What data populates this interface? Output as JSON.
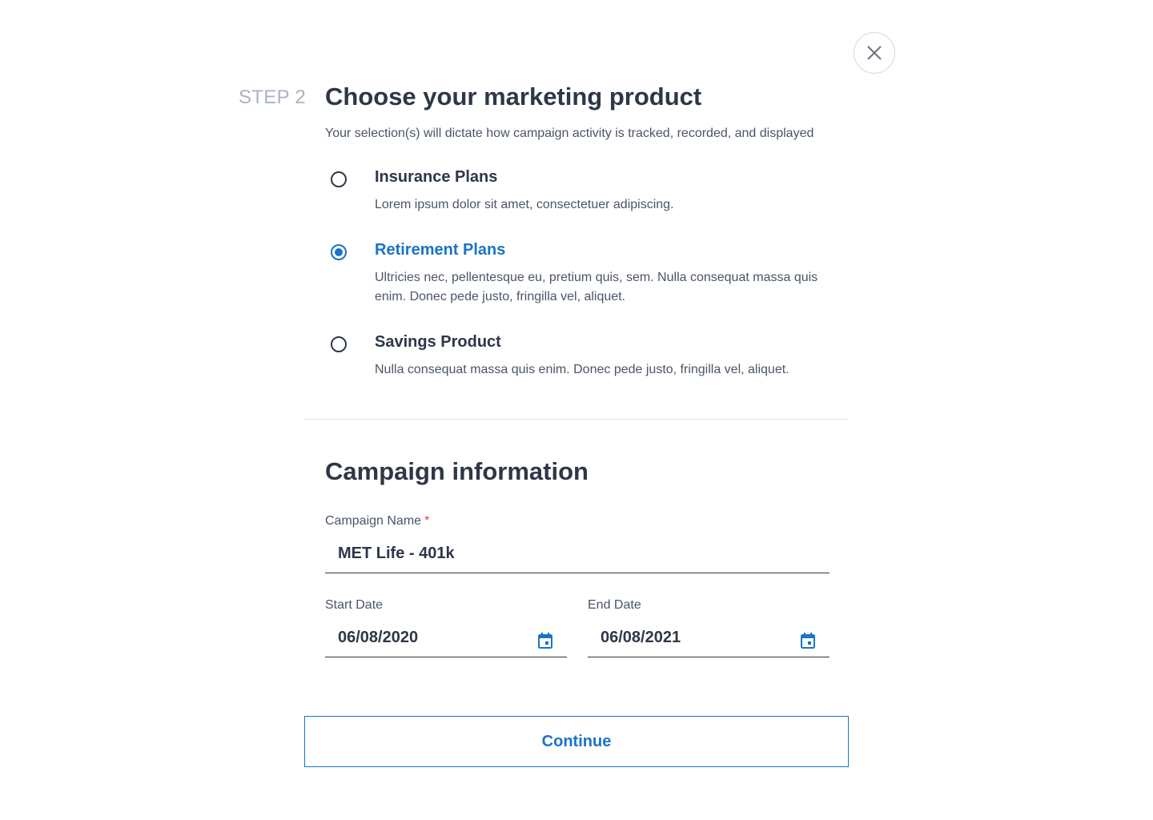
{
  "header": {
    "step": "STEP 2",
    "title": "Choose your marketing product",
    "subtitle": "Your selection(s) will dictate how campaign activity is tracked, recorded, and displayed"
  },
  "products": [
    {
      "title": "Insurance Plans",
      "description": "Lorem ipsum dolor sit amet, consectetuer adipiscing.",
      "selected": false
    },
    {
      "title": "Retirement Plans",
      "description": "Ultricies nec, pellentesque eu, pretium quis, sem. Nulla consequat massa quis enim. Donec pede justo, fringilla vel, aliquet.",
      "selected": true
    },
    {
      "title": "Savings Product",
      "description": "Nulla consequat massa quis enim. Donec pede justo, fringilla vel, aliquet.",
      "selected": false
    }
  ],
  "campaign": {
    "title": "Campaign information",
    "name_label": "Campaign Name",
    "required_mark": "*",
    "name_value": "MET Life - 401k",
    "start_label": "Start Date",
    "start_value": "06/08/2020",
    "end_label": "End Date",
    "end_value": "06/08/2021"
  },
  "actions": {
    "continue_label": "Continue"
  },
  "colors": {
    "accent": "#1a73c8",
    "text": "#2d3748",
    "muted": "#a9b3c1",
    "required": "#e53e3e"
  },
  "icons": {
    "close": "close-icon",
    "calendar": "calendar-icon"
  }
}
